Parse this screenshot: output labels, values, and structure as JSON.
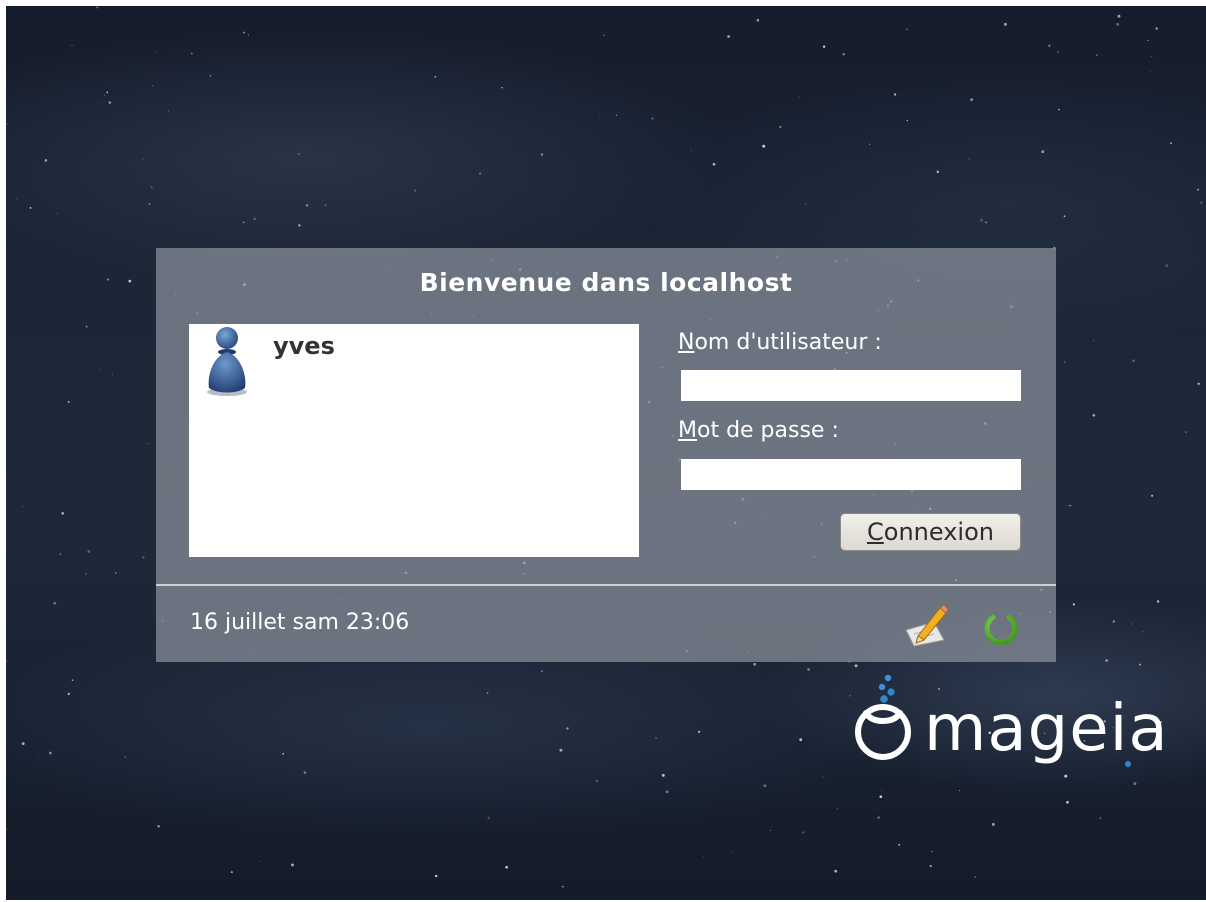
{
  "greeter": {
    "welcome": "Bienvenue dans localhost",
    "users": [
      {
        "name": "yves",
        "icon": "user-avatar-icon"
      }
    ],
    "username_label_key": "N",
    "username_label_rest": "om d'utilisateur :",
    "username_value": "",
    "password_label_key": "M",
    "password_label_rest": "ot de passe :",
    "password_value": "",
    "connect_key": "C",
    "connect_rest": "onnexion",
    "datetime": "16 juillet sam 23:06"
  },
  "actions": {
    "session_icon": "pencil-paper-icon",
    "power_icon": "power-icon"
  },
  "branding": {
    "logo_text": "mageia",
    "logo_icon": "mageia-cauldron-icon"
  },
  "colors": {
    "panel": "#8c929c",
    "power_green": "#5cb82e",
    "logo_blue": "#2f86d1"
  }
}
